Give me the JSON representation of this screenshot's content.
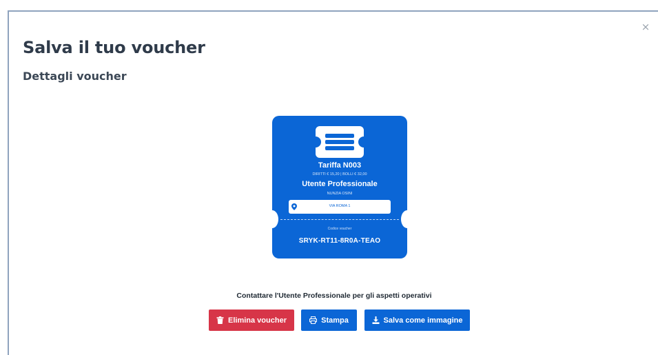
{
  "modal": {
    "close_label": "×",
    "title": "Salva il tuo voucher",
    "subtitle": "Dettagli voucher"
  },
  "voucher": {
    "tariff": "Tariffa N003",
    "fees": "DIRITTI € 15,20 | BOLLI € 32,00",
    "user_type": "Utente Professionale",
    "user_name": "NUNZIA OSINI",
    "address": "VIA ROMA 1",
    "code_label": "Codice voucher",
    "code": "SRYK-RT11-8R0A-TEAO"
  },
  "contact_note": "Contattare l'Utente Professionale per gli aspetti operativi",
  "actions": {
    "delete_label": "Elimina voucher",
    "print_label": "Stampa",
    "save_label": "Salva come immagine"
  },
  "colors": {
    "primary": "#0b66d6",
    "danger": "#d73548",
    "title": "#2f3b4a"
  },
  "icons": {
    "voucher": "ticket-icon",
    "address": "map-pin-icon",
    "delete": "trash-icon",
    "print": "printer-icon",
    "save": "download-icon"
  }
}
